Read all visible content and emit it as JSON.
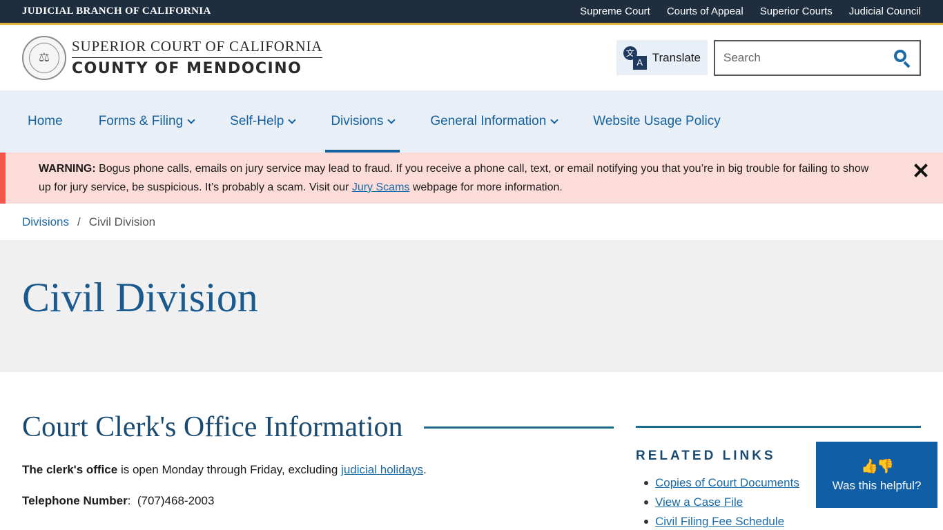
{
  "topbar": {
    "brand": "JUDICIAL BRANCH OF CALIFORNIA",
    "links": [
      "Supreme Court",
      "Courts of Appeal",
      "Superior Courts",
      "Judicial Council"
    ]
  },
  "header": {
    "logo_line1": "SUPERIOR COURT OF CALIFORNIA",
    "logo_line2": "COUNTY OF MENDOCINO",
    "translate_label": "Translate",
    "search_placeholder": "Search"
  },
  "nav": {
    "items": [
      {
        "label": "Home"
      },
      {
        "label": "Forms & Filing"
      },
      {
        "label": "Self-Help"
      },
      {
        "label": "Divisions"
      },
      {
        "label": "General Information"
      },
      {
        "label": "Website Usage Policy"
      }
    ]
  },
  "alert": {
    "prefix": "WARNING:",
    "text_before_link": " Bogus phone calls, emails on jury service may lead to fraud.  If you receive a phone call, text, or email notifying you that you’re in big trouble for failing to show up for jury service, be suspicious.  It’s probably a scam.  Visit our ",
    "link_text": "Jury Scams",
    "text_after_link": " webpage for more information."
  },
  "breadcrumb": {
    "parent": "Divisions",
    "separator": "/",
    "current": "Civil Division"
  },
  "page": {
    "title": "Civil Division"
  },
  "main": {
    "section_title": "Court Clerk's Office Information",
    "hours_bold": "The clerk's office",
    "hours_text": " is open Monday through Friday, excluding ",
    "hours_link": "judicial holidays",
    "hours_end": ".",
    "phone_label": "Telephone Number",
    "phone_value": "(707)468-2003"
  },
  "sidebar": {
    "heading": "RELATED LINKS",
    "links": [
      "Copies of Court Documents",
      "View a Case File",
      "Civil Filing Fee Schedule"
    ]
  },
  "feedback": {
    "label": "Was this helpful?"
  },
  "colors": {
    "topbar_bg": "#1e2e3f",
    "accent_gold": "#e2b13c",
    "nav_bg": "#e8eff6",
    "link_blue": "#1561a0",
    "alert_bg": "#fcdcd8",
    "alert_border": "#f0584a",
    "title_blue": "#1a5a8f",
    "feedback_bg": "#0f5ea6"
  }
}
